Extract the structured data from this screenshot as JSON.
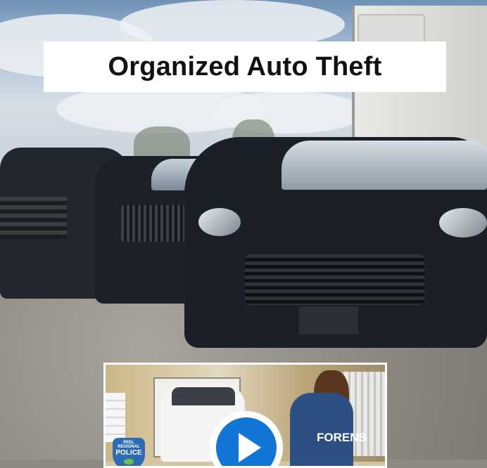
{
  "title": "Organized Auto Theft",
  "video": {
    "badge_top": "PEEL REGIONAL",
    "badge_main": "POLICE",
    "vest_text": "FORENS",
    "play_icon": "play-button-icon",
    "accent_color": "#1176d6"
  }
}
